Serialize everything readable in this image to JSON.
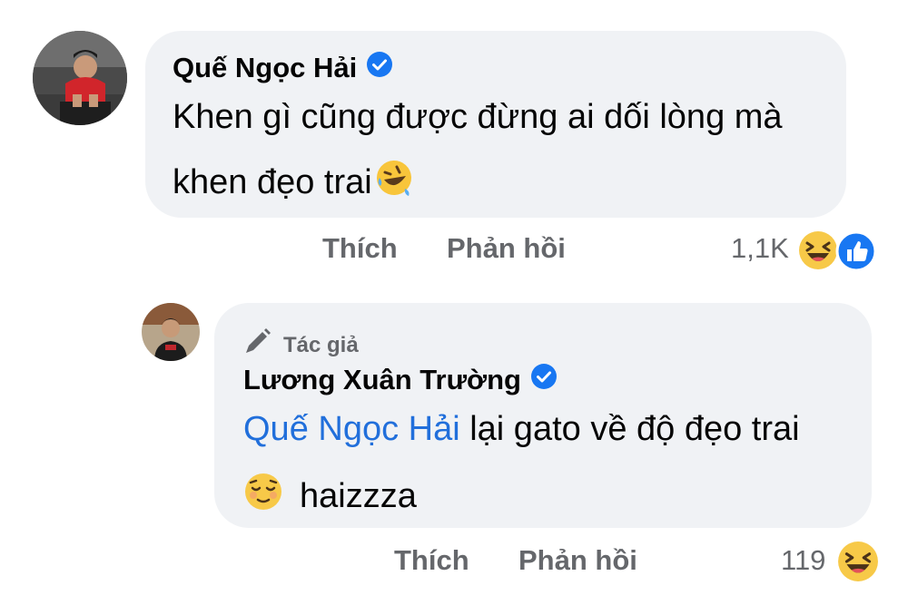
{
  "comment": {
    "author_name": "Quế Ngọc Hải",
    "text_line1": "Khen gì cũng được đừng ai dối lòng mà",
    "text_line2": "khen đẹo trai",
    "like_label": "Thích",
    "reply_label": "Phản hồi",
    "reaction_count": "1,1K",
    "reactions": [
      "haha",
      "like"
    ]
  },
  "reply": {
    "author_tag": "Tác giả",
    "author_name": "Lương Xuân Trường",
    "mention": "Quế Ngọc Hải",
    "text_line1_rest": " lại gato về độ đẹo trai",
    "text_line2": "haizzza",
    "like_label": "Thích",
    "reply_label": "Phản hồi",
    "reaction_count": "119",
    "reactions": [
      "haha"
    ]
  },
  "colors": {
    "bubble": "#f0f2f5",
    "verified": "#1877f2",
    "mention": "#216fdb",
    "muted": "#65676b"
  }
}
